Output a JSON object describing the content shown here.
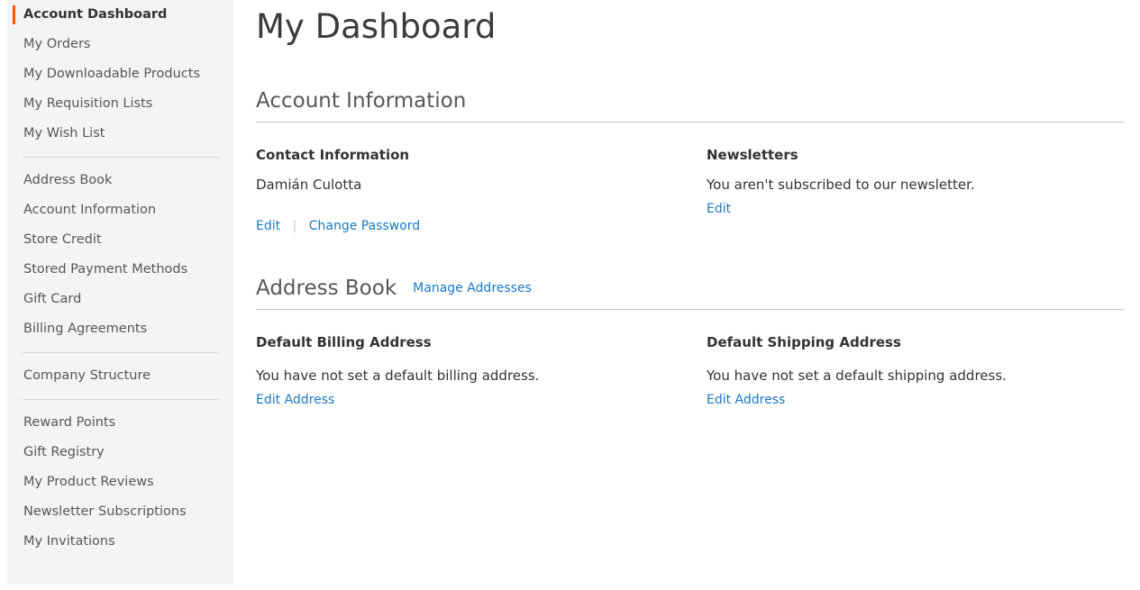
{
  "sidebar": {
    "groups": [
      {
        "items": [
          {
            "label": "Account Dashboard",
            "current": true
          },
          {
            "label": "My Orders",
            "current": false
          },
          {
            "label": "My Downloadable Products",
            "current": false
          },
          {
            "label": "My Requisition Lists",
            "current": false
          },
          {
            "label": "My Wish List",
            "current": false
          }
        ]
      },
      {
        "items": [
          {
            "label": "Address Book",
            "current": false
          },
          {
            "label": "Account Information",
            "current": false
          },
          {
            "label": "Store Credit",
            "current": false
          },
          {
            "label": "Stored Payment Methods",
            "current": false
          },
          {
            "label": "Gift Card",
            "current": false
          },
          {
            "label": "Billing Agreements",
            "current": false
          }
        ]
      },
      {
        "items": [
          {
            "label": "Company Structure",
            "current": false
          }
        ]
      },
      {
        "items": [
          {
            "label": "Reward Points",
            "current": false
          },
          {
            "label": "Gift Registry",
            "current": false
          },
          {
            "label": "My Product Reviews",
            "current": false
          },
          {
            "label": "Newsletter Subscriptions",
            "current": false
          },
          {
            "label": "My Invitations",
            "current": false
          }
        ]
      }
    ],
    "active_marker_color": "#ff5501",
    "background_color": "#f4f4f4"
  },
  "main": {
    "page_title": "My Dashboard",
    "account_information": {
      "title": "Account Information",
      "contact": {
        "title": "Contact Information",
        "name": "Damián Culotta",
        "edit_label": "Edit",
        "separator": "|",
        "change_password_label": "Change Password"
      },
      "newsletters": {
        "title": "Newsletters",
        "status": "You aren't subscribed to our newsletter.",
        "edit_label": "Edit"
      }
    },
    "address_book": {
      "title": "Address Book",
      "manage_label": "Manage Addresses",
      "billing": {
        "title": "Default Billing Address",
        "status": "You have not set a default billing address.",
        "edit_label": "Edit Address"
      },
      "shipping": {
        "title": "Default Shipping Address",
        "status": "You have not set a default shipping address.",
        "edit_label": "Edit Address"
      }
    }
  },
  "colors": {
    "link": "#1979c3",
    "accent": "#ff5501",
    "sidebar_bg": "#f4f4f4",
    "rule": "#c6c6c6",
    "text": "#333333",
    "muted_text": "#575757"
  }
}
